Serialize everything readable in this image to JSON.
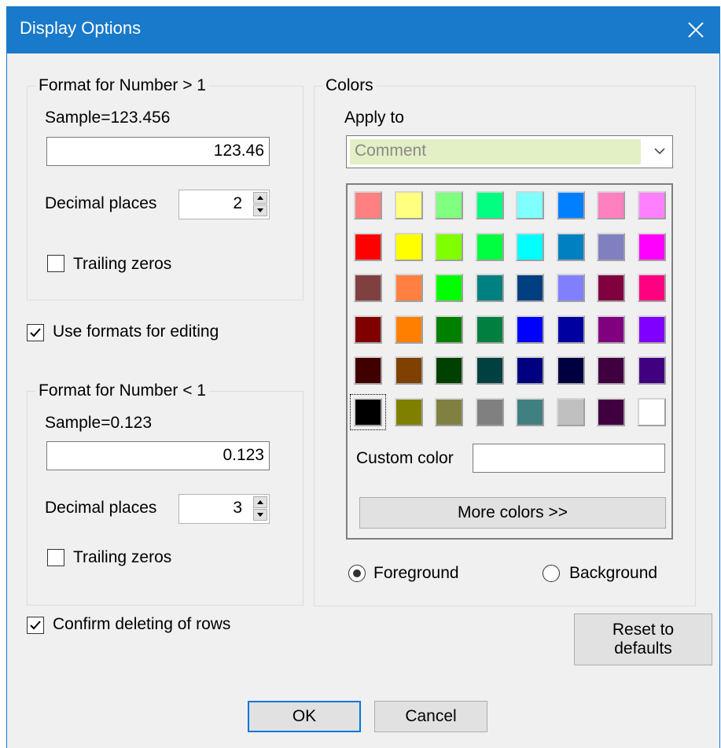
{
  "window": {
    "title": "Display Options"
  },
  "group_gt1": {
    "legend": "Format for Number > 1",
    "sample_label": "Sample=123.456",
    "value": "123.46",
    "decimal_label": "Decimal places",
    "decimal_value": "2",
    "trailing_label": "Trailing zeros",
    "trailing_checked": false
  },
  "use_formats": {
    "label": "Use formats for editing",
    "checked": true
  },
  "group_lt1": {
    "legend": "Format for Number < 1",
    "sample_label": "Sample=0.123",
    "value": "0.123",
    "decimal_label": "Decimal places",
    "decimal_value": "3",
    "trailing_label": "Trailing zeros",
    "trailing_checked": false
  },
  "confirm_delete": {
    "label": "Confirm deleting of rows",
    "checked": true
  },
  "colors": {
    "legend": "Colors",
    "apply_to_label": "Apply to",
    "apply_to_value": "Comment",
    "custom_color_label": "Custom color",
    "custom_color_value": "",
    "more_colors_label": "More colors >>",
    "foreground_label": "Foreground",
    "background_label": "Background",
    "selected_mode": "foreground",
    "selected_swatch": 40,
    "swatches": [
      "#ff8080",
      "#ffff80",
      "#80ff80",
      "#00ff80",
      "#80ffff",
      "#0080ff",
      "#ff80c0",
      "#ff80ff",
      "#ff0000",
      "#ffff00",
      "#80ff00",
      "#00ff40",
      "#00ffff",
      "#0080c0",
      "#8080c0",
      "#ff00ff",
      "#804040",
      "#ff8040",
      "#00ff00",
      "#008080",
      "#004080",
      "#8080ff",
      "#800040",
      "#ff0080",
      "#800000",
      "#ff8000",
      "#008000",
      "#008040",
      "#0000ff",
      "#0000a0",
      "#800080",
      "#8000ff",
      "#400000",
      "#804000",
      "#004000",
      "#004040",
      "#000080",
      "#000040",
      "#400040",
      "#400080",
      "#000000",
      "#808000",
      "#808040",
      "#808080",
      "#408080",
      "#c0c0c0",
      "#400040",
      "#ffffff"
    ]
  },
  "buttons": {
    "reset_line1": "Reset to",
    "reset_line2": "defaults",
    "ok": "OK",
    "cancel": "Cancel"
  }
}
